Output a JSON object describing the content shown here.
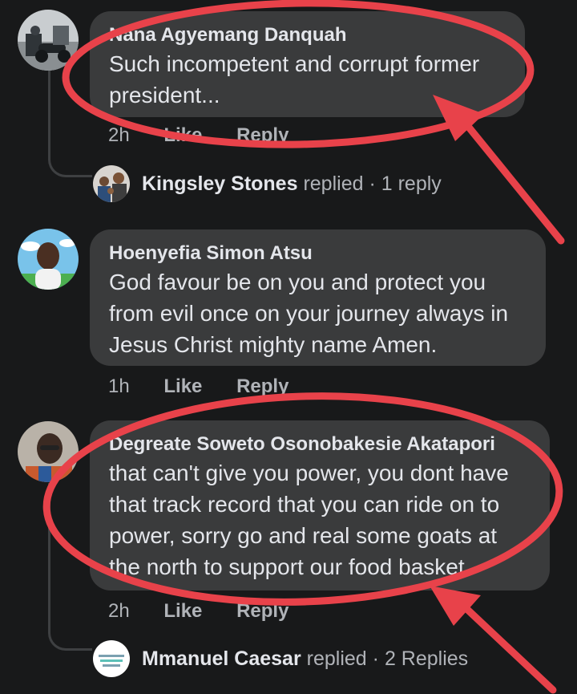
{
  "comments": [
    {
      "author": "Nana Agyemang Danquah",
      "text": "Such incompetent and corrupt former president...",
      "time": "2h",
      "like": "Like",
      "reply": "Reply",
      "reply_summary": {
        "name": "Kingsley Stones",
        "verb": "replied",
        "count": "· 1 reply"
      }
    },
    {
      "author": "Hoenyefia Simon Atsu",
      "text": "God  favour be on you and protect you from evil once on your journey always in Jesus Christ mighty name Amen.",
      "time": "1h",
      "like": "Like",
      "reply": "Reply"
    },
    {
      "author": "Degreate Soweto Osonobakesie Akatapori",
      "text": "that can't give you power, you dont have that track record that you can ride on to power, sorry go and real some goats at the north to support our food basket",
      "time": "2h",
      "like": "Like",
      "reply": "Reply",
      "reply_summary": {
        "name": "Mmanuel Caesar",
        "verb": "replied",
        "count": "· 2 Replies"
      }
    }
  ],
  "annotation_color": "#e8424a"
}
